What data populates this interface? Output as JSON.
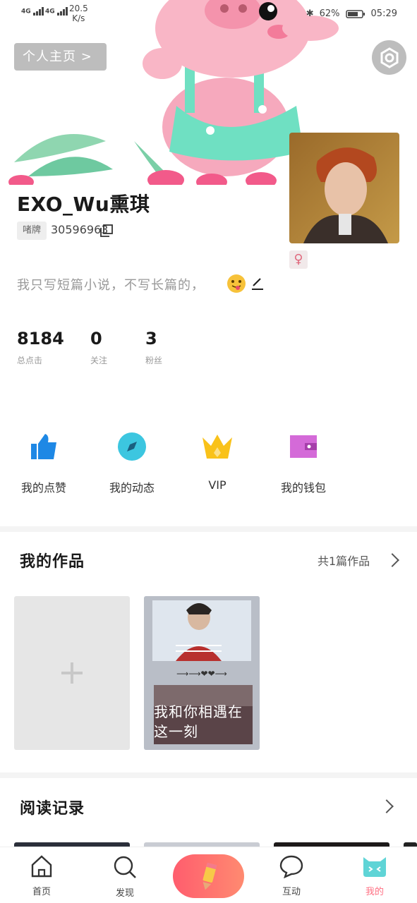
{
  "status_bar": {
    "signal1": "4G",
    "signal2": "4G",
    "speed_value": "20.5",
    "speed_unit": "K/s",
    "battery": "62%",
    "time": "05:29"
  },
  "header": {
    "homepage_button": "个人主页 >"
  },
  "profile": {
    "name": "EXO_Wu熏琪",
    "tag": "啫牌",
    "uid": "30596963",
    "gender_symbol": "♀",
    "bio": "我只写短篇小说，不写长篇的，"
  },
  "stats": [
    {
      "value": "8184",
      "label": "总点击"
    },
    {
      "value": "0",
      "label": "关注"
    },
    {
      "value": "3",
      "label": "粉丝"
    }
  ],
  "shortcuts": [
    {
      "label": "我的点赞",
      "icon": "thumbs-up-icon",
      "color": "#1e88e5"
    },
    {
      "label": "我的动态",
      "icon": "compass-icon",
      "color": "#3cc6e0"
    },
    {
      "label": "VIP",
      "icon": "crown-icon",
      "color": "#f9c21a"
    },
    {
      "label": "我的钱包",
      "icon": "wallet-icon",
      "color": "#d46ad8"
    }
  ],
  "works": {
    "title": "我的作品",
    "count_label": "共1篇作品",
    "items": [
      {
        "title": "我和你相遇在这一刻"
      }
    ]
  },
  "reading": {
    "title": "阅读记录"
  },
  "tabbar": {
    "items": [
      {
        "label": "首页"
      },
      {
        "label": "发现"
      },
      {
        "label": "互动"
      },
      {
        "label": "我的"
      }
    ]
  },
  "colors": {
    "accent_pink": "#ff6a6f",
    "active_tab": "#ff6f82"
  }
}
